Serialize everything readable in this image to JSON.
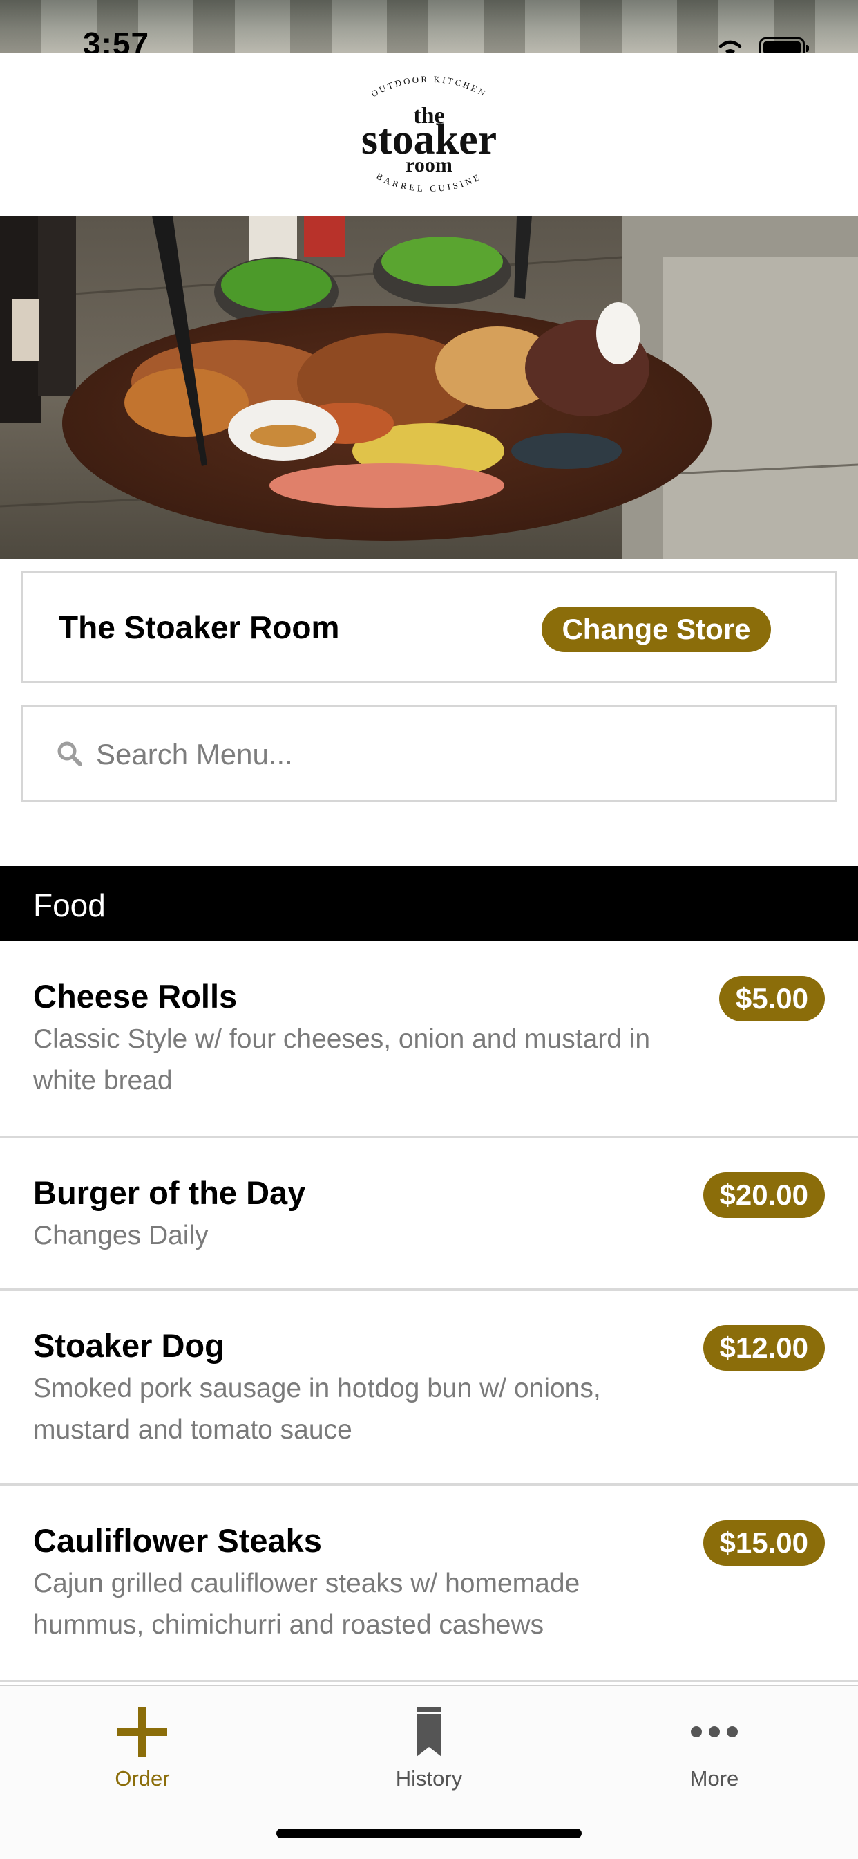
{
  "status_bar": {
    "time": "3:57"
  },
  "brand": {
    "logo_top_arc": "OUTDOOR KITCHEN",
    "logo_the": "the",
    "logo_main": "stoaker",
    "logo_room": "room",
    "logo_bottom_arc": "BARREL CUISINE",
    "accent_color": "#8b6d0a"
  },
  "store": {
    "name": "The Stoaker Room",
    "change_label": "Change Store"
  },
  "search": {
    "placeholder": "Search Menu..."
  },
  "menu": {
    "category": "Food",
    "items": [
      {
        "name": "Cheese Rolls",
        "description": "Classic Style w/ four cheeses, onion and mustard in white bread",
        "price": "$5.00"
      },
      {
        "name": "Burger of the Day",
        "description": "Changes Daily",
        "price": "$20.00"
      },
      {
        "name": "Stoaker Dog",
        "description": "Smoked pork sausage in hotdog bun w/ onions, mustard and tomato sauce",
        "price": "$12.00"
      },
      {
        "name": "Cauliflower Steaks",
        "description": "Cajun grilled cauliflower steaks w/ homemade hummus, chimichurri and roasted cashews",
        "price": "$15.00"
      }
    ]
  },
  "tab_bar": {
    "tabs": [
      {
        "label": "Order",
        "icon": "plus-icon",
        "active": true
      },
      {
        "label": "History",
        "icon": "bookmark-icon",
        "active": false
      },
      {
        "label": "More",
        "icon": "more-dots-icon",
        "active": false
      }
    ]
  }
}
